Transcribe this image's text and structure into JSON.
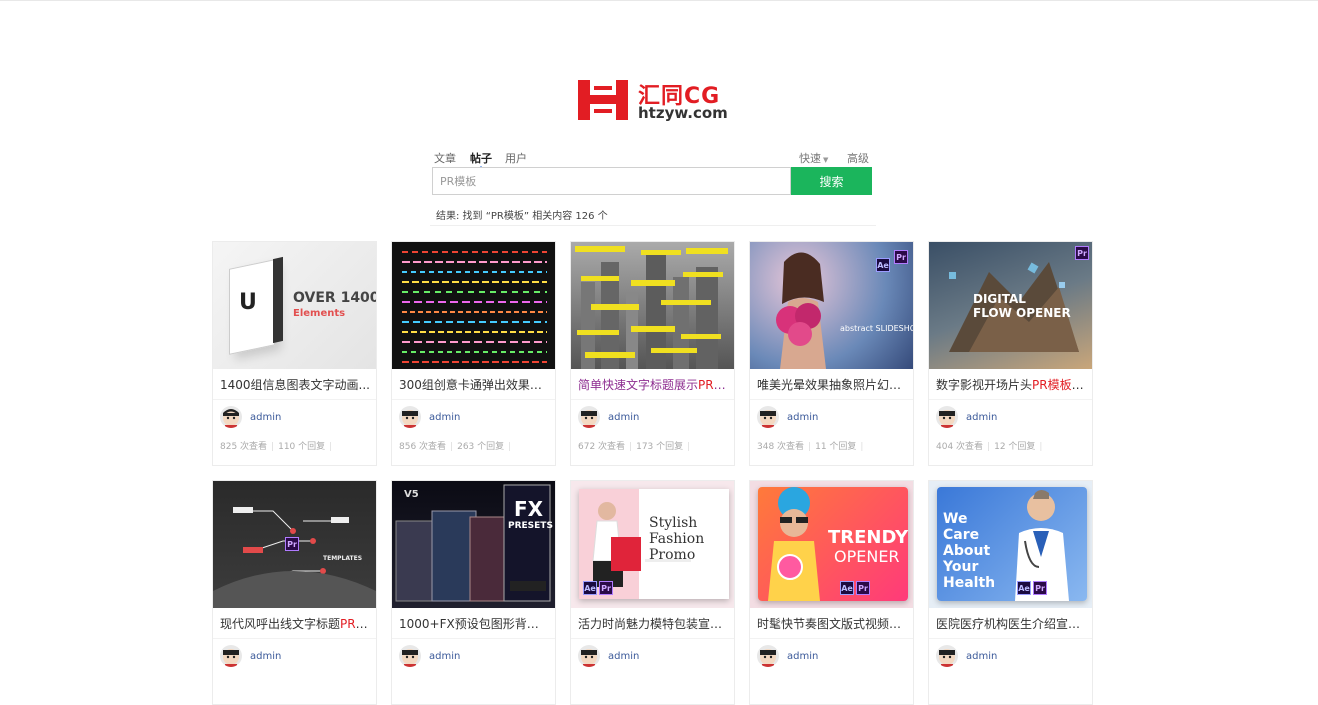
{
  "logo": {
    "cn": "汇同CG",
    "en": "htzyw.com"
  },
  "search": {
    "tabs": [
      "文章",
      "帖子",
      "用户"
    ],
    "active_tab": "帖子",
    "quick_label": "快速",
    "advanced_label": "高级",
    "input_value": "PR模板",
    "button_label": "搜索"
  },
  "results": {
    "summary": "结果: 找到 “PR模板” 相关内容 126 个"
  },
  "cards": [
    {
      "title_pre": "1400组信息图表文字动画...",
      "title_hl": "",
      "title_post": "",
      "author": "admin",
      "views": "825 次查看",
      "replies": "110 个回复",
      "thumb_text": "OVER 1400",
      "thumb_sub": "Elements"
    },
    {
      "title_pre": "300组创意卡通弹出效果文...",
      "title_hl": "",
      "title_post": "",
      "author": "admin",
      "views": "856 次查看",
      "replies": "263 个回复"
    },
    {
      "title_pre": "简单快速文字标题展示",
      "title_hl": "PR模...",
      "title_post": "",
      "author": "admin",
      "views": "672 次查看",
      "replies": "173 个回复"
    },
    {
      "title_pre": "唯美光晕效果抽象照片幻灯...",
      "title_hl": "",
      "title_post": "",
      "author": "admin",
      "views": "348 次查看",
      "replies": "11 个回复",
      "thumb_text": "abstract SLIDESHOW"
    },
    {
      "title_pre": "数字影视开场片头",
      "title_hl": "PR模板",
      "title_post": " ...",
      "author": "admin",
      "views": "404 次查看",
      "replies": "12 个回复",
      "thumb_text": "DIGITAL",
      "thumb_sub": "FLOW OPENER"
    },
    {
      "title_pre": "现代风呼出线文字标题",
      "title_hl": "PR模...",
      "title_post": "",
      "author": "admin",
      "thumb_text": "TEMPLATES"
    },
    {
      "title_pre": "1000+FX预设包图形背景标...",
      "title_hl": "",
      "title_post": "",
      "author": "admin",
      "thumb_text": "FX",
      "thumb_sub": "PRESETS"
    },
    {
      "title_pre": "活力时尚魅力模特包装宣传...",
      "title_hl": "",
      "title_post": "",
      "author": "admin",
      "thumb_text": "Stylish",
      "thumb_sub": "Fashion",
      "thumb_sub2": "Promo"
    },
    {
      "title_pre": "时髦快节奏图文版式视频片...",
      "title_hl": "",
      "title_post": "",
      "author": "admin",
      "thumb_text": "TRENDY",
      "thumb_sub": "OPENER"
    },
    {
      "title_pre": "医院医疗机构医生介绍宣传...",
      "title_hl": "",
      "title_post": "",
      "author": "admin",
      "thumb_text": "We",
      "thumb_sub": "Care",
      "thumb_sub2": "About",
      "thumb_sub3": "Your",
      "thumb_sub4": "Health"
    }
  ],
  "badges": {
    "pr": "Pr",
    "ae": "Ae"
  },
  "colors": {
    "accent_green": "#1bb55c",
    "brand_red": "#e21d23",
    "highlight_red": "#e21d23",
    "visited_purple": "#8e2e91",
    "author_blue": "#3c5a9a"
  }
}
